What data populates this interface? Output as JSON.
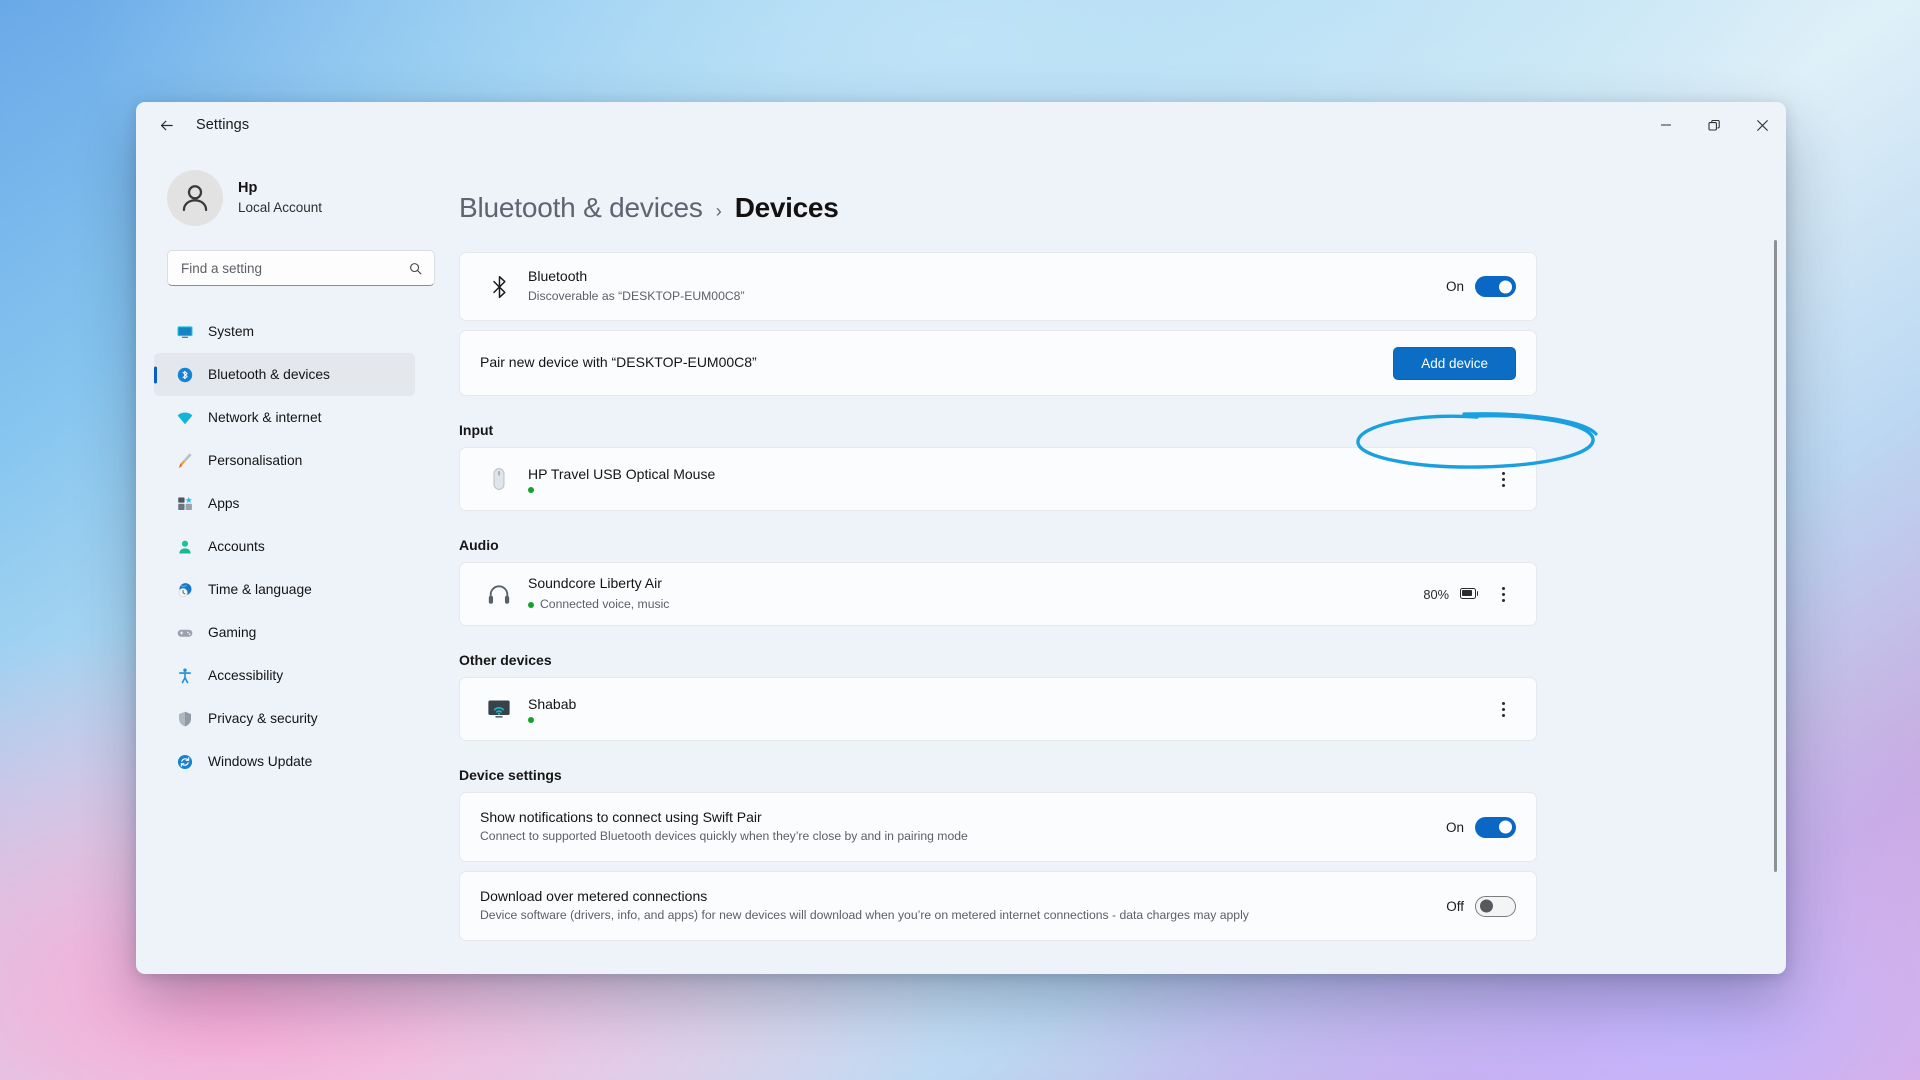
{
  "window": {
    "app_title": "Settings",
    "back_icon": "back-arrow-icon",
    "minimize_label": "Minimise",
    "maximize_label": "Restore",
    "close_label": "Close"
  },
  "account": {
    "name": "Hp",
    "type": "Local Account",
    "avatar_icon": "person-icon"
  },
  "search": {
    "placeholder": "Find a setting",
    "value": "",
    "icon": "search-icon"
  },
  "sidebar": {
    "items": [
      {
        "label": "System",
        "icon": "monitor-icon",
        "active": false
      },
      {
        "label": "Bluetooth & devices",
        "icon": "bluetooth-icon",
        "active": true
      },
      {
        "label": "Network & internet",
        "icon": "wifi-icon",
        "active": false
      },
      {
        "label": "Personalisation",
        "icon": "paintbrush-icon",
        "active": false
      },
      {
        "label": "Apps",
        "icon": "apps-grid-icon",
        "active": false
      },
      {
        "label": "Accounts",
        "icon": "account-icon",
        "active": false
      },
      {
        "label": "Time & language",
        "icon": "clock-globe-icon",
        "active": false
      },
      {
        "label": "Gaming",
        "icon": "gamepad-icon",
        "active": false
      },
      {
        "label": "Accessibility",
        "icon": "accessibility-icon",
        "active": false
      },
      {
        "label": "Privacy & security",
        "icon": "shield-icon",
        "active": false
      },
      {
        "label": "Windows Update",
        "icon": "update-icon",
        "active": false
      }
    ]
  },
  "breadcrumb": {
    "parent": "Bluetooth & devices",
    "separator": "›",
    "current": "Devices"
  },
  "bluetooth_card": {
    "icon": "bluetooth-icon",
    "title": "Bluetooth",
    "subtitle": "Discoverable as “DESKTOP-EUM00C8”",
    "toggle_label": "On",
    "toggle_state": "on"
  },
  "pair_card": {
    "text": "Pair new device with “DESKTOP-EUM00C8”",
    "button_label": "Add device",
    "highlighted": true
  },
  "sections": [
    {
      "heading": "Input",
      "devices": [
        {
          "name": "HP Travel USB Optical Mouse",
          "status": "",
          "icon": "mouse-icon",
          "status_dot": true,
          "battery_percent": "",
          "menu_icon": "kebab-menu-icon"
        }
      ]
    },
    {
      "heading": "Audio",
      "devices": [
        {
          "name": "Soundcore Liberty Air",
          "status": "Connected voice, music",
          "icon": "headphones-icon",
          "status_dot": true,
          "battery_percent": "80%",
          "menu_icon": "kebab-menu-icon"
        }
      ]
    },
    {
      "heading": "Other devices",
      "devices": [
        {
          "name": "Shabab",
          "status": "",
          "icon": "wireless-display-icon",
          "status_dot": true,
          "battery_percent": "",
          "menu_icon": "kebab-menu-icon"
        }
      ]
    }
  ],
  "device_settings": {
    "heading": "Device settings",
    "rows": [
      {
        "title": "Show notifications to connect using Swift Pair",
        "subtitle": "Connect to supported Bluetooth devices quickly when they’re close by and in pairing mode",
        "toggle_label": "On",
        "toggle_state": "on"
      },
      {
        "title": "Download over metered connections",
        "subtitle": "Device software (drivers, info, and apps) for new devices will download when you’re on metered internet connections - data charges may apply",
        "toggle_label": "Off",
        "toggle_state": "off"
      }
    ]
  },
  "colors": {
    "accent": "#0b6ec4",
    "toggle_on": "#0a68c4",
    "annotation": "#1aa0e0",
    "status_green": "#12a42a",
    "nav_active_bar": "#0b5ec7"
  }
}
